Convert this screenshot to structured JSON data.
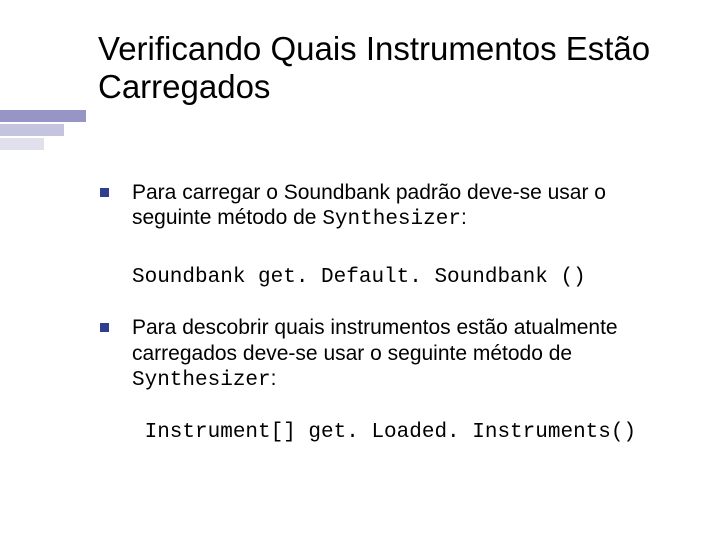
{
  "title": "Verificando Quais Instrumentos Estão Carregados",
  "bullets": [
    {
      "text_before": "Para carregar o Soundbank padrão deve-se usar o seguinte método de ",
      "code_inline": "Synthesizer",
      "text_after": ":"
    },
    {
      "text_before": "Para descobrir quais instrumentos estão atualmente carregados deve-se usar o seguinte método de ",
      "code_inline": "Synthesizer",
      "text_after": ":"
    }
  ],
  "code_lines": [
    "Soundbank get. Default. Soundbank ()",
    " Instrument[] get. Loaded. Instruments()"
  ]
}
